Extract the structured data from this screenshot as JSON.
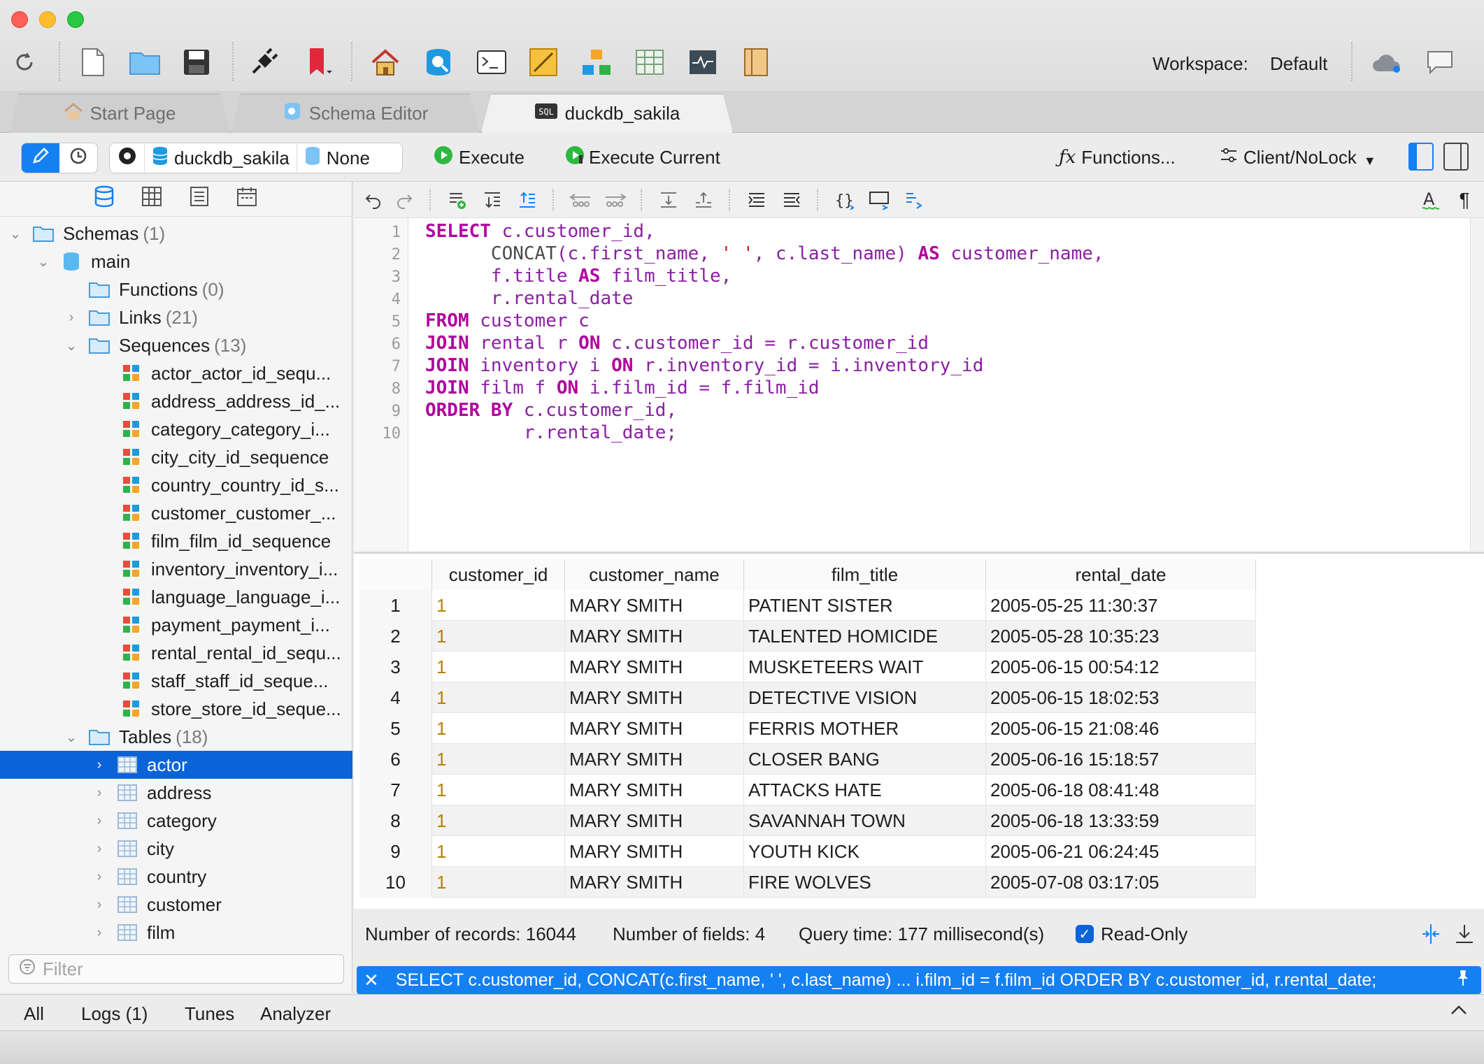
{
  "toolbar": {
    "workspace_label": "Workspace:",
    "workspace_value": "Default",
    "icons": [
      "refresh-icon",
      "new-file-icon",
      "open-folder-icon",
      "save-icon",
      "connect-plug-icon",
      "bookmark-icon",
      "home-icon",
      "db-search-icon",
      "terminal-icon",
      "design-icon",
      "diagram-icon",
      "table-icon",
      "activity-icon",
      "notebook-icon",
      "cloud-icon",
      "chat-icon"
    ]
  },
  "tabs": [
    {
      "label": "Start Page",
      "icon": "home-icon",
      "active": false
    },
    {
      "label": "Schema Editor",
      "icon": "schema-icon",
      "active": false
    },
    {
      "label": "duckdb_sakila",
      "icon": "sql-icon",
      "active": true
    }
  ],
  "toolbar2": {
    "database": "duckdb_sakila",
    "schema": "None",
    "execute": "Execute",
    "execute_current": "Execute Current",
    "functions": "Functions...",
    "client_mode": "Client/NoLock"
  },
  "tree": {
    "schemas": {
      "label": "Schemas",
      "count": "(1)"
    },
    "main": {
      "label": "main"
    },
    "functions": {
      "label": "Functions",
      "count": "(0)"
    },
    "links": {
      "label": "Links",
      "count": "(21)"
    },
    "sequences": {
      "label": "Sequences",
      "count": "(13)"
    },
    "sequence_items": [
      "actor_actor_id_sequ...",
      "address_address_id_...",
      "category_category_i...",
      "city_city_id_sequence",
      "country_country_id_s...",
      "customer_customer_...",
      "film_film_id_sequence",
      "inventory_inventory_i...",
      "language_language_i...",
      "payment_payment_i...",
      "rental_rental_id_sequ...",
      "staff_staff_id_seque...",
      "store_store_id_seque..."
    ],
    "tables": {
      "label": "Tables",
      "count": "(18)"
    },
    "table_items": [
      "actor",
      "address",
      "category",
      "city",
      "country",
      "customer",
      "film"
    ],
    "filter_placeholder": "Filter"
  },
  "editor": {
    "line_numbers": [
      "1",
      "2",
      "3",
      "4",
      "5",
      "6",
      "7",
      "8",
      "9",
      "10"
    ]
  },
  "results": {
    "columns": [
      "customer_id",
      "customer_name",
      "film_title",
      "rental_date"
    ],
    "rows": [
      {
        "n": "1",
        "customer_id": "1",
        "customer_name": "MARY SMITH",
        "film_title": "PATIENT SISTER",
        "rental_date": "2005-05-25 11:30:37"
      },
      {
        "n": "2",
        "customer_id": "1",
        "customer_name": "MARY SMITH",
        "film_title": "TALENTED HOMICIDE",
        "rental_date": "2005-05-28 10:35:23"
      },
      {
        "n": "3",
        "customer_id": "1",
        "customer_name": "MARY SMITH",
        "film_title": "MUSKETEERS WAIT",
        "rental_date": "2005-06-15 00:54:12"
      },
      {
        "n": "4",
        "customer_id": "1",
        "customer_name": "MARY SMITH",
        "film_title": "DETECTIVE VISION",
        "rental_date": "2005-06-15 18:02:53"
      },
      {
        "n": "5",
        "customer_id": "1",
        "customer_name": "MARY SMITH",
        "film_title": "FERRIS MOTHER",
        "rental_date": "2005-06-15 21:08:46"
      },
      {
        "n": "6",
        "customer_id": "1",
        "customer_name": "MARY SMITH",
        "film_title": "CLOSER BANG",
        "rental_date": "2005-06-16 15:18:57"
      },
      {
        "n": "7",
        "customer_id": "1",
        "customer_name": "MARY SMITH",
        "film_title": "ATTACKS HATE",
        "rental_date": "2005-06-18 08:41:48"
      },
      {
        "n": "8",
        "customer_id": "1",
        "customer_name": "MARY SMITH",
        "film_title": "SAVANNAH TOWN",
        "rental_date": "2005-06-18 13:33:59"
      },
      {
        "n": "9",
        "customer_id": "1",
        "customer_name": "MARY SMITH",
        "film_title": "YOUTH KICK",
        "rental_date": "2005-06-21 06:24:45"
      },
      {
        "n": "10",
        "customer_id": "1",
        "customer_name": "MARY SMITH",
        "film_title": "FIRE WOLVES",
        "rental_date": "2005-07-08 03:17:05"
      }
    ]
  },
  "status": {
    "records_label": "Number of records:",
    "records_value": "16044",
    "fields_label": "Number of fields:",
    "fields_value": "4",
    "time_label": "Query time:",
    "time_value": "177 millisecond(s)",
    "readonly_label": "Read-Only",
    "readonly_checked": true
  },
  "history": {
    "query": "SELECT c.customer_id, CONCAT(c.first_name, ' ', c.last_name) ... i.film_id = f.film_id ORDER BY c.customer_id, r.rental_date;"
  },
  "bottom_tabs": [
    "All",
    "Logs (1)",
    "Tunes",
    "Analyzer"
  ],
  "colors": {
    "accent": "#0a64d8",
    "history_bar": "#1580f2",
    "keyword": "#b1009e",
    "identifier": "#8a1fa3",
    "string": "#c41a16"
  }
}
